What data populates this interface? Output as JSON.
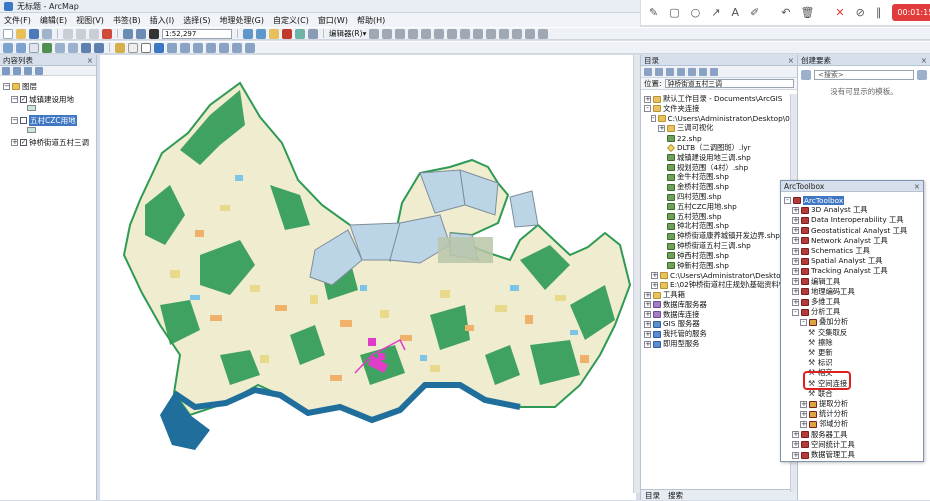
{
  "window": {
    "title": "无标题 - ArcMap"
  },
  "menubar": [
    "文件(F)",
    "编辑(E)",
    "视图(V)",
    "书签(B)",
    "插入(I)",
    "选择(S)",
    "地理处理(G)",
    "自定义(C)",
    "窗口(W)",
    "帮助(H)"
  ],
  "toolbar": {
    "scale": "1:52,297",
    "editor_label": "编辑器(R)▾"
  },
  "recorder": {
    "timer": "00:01:15 结束"
  },
  "toc": {
    "title": "内容列表",
    "root": "图层",
    "layers": [
      {
        "name": "城镇建设用地",
        "checked": true,
        "swatch": "#c6e7e2"
      },
      {
        "name": "五村CZC用地",
        "checked": false,
        "selected": true,
        "swatch": "#c6e7e2"
      },
      {
        "name": "钟桥街道五村三调",
        "checked": true,
        "swatch": ""
      }
    ]
  },
  "catalog": {
    "title": "目录",
    "location_label": "位置:",
    "location_value": "钟桥街道五村三调",
    "items": [
      {
        "label": "默认工作目录 - Documents\\ArcGIS",
        "indent": 0,
        "icon": "folder",
        "exp": "+"
      },
      {
        "label": "文件夹连接",
        "indent": 0,
        "icon": "folder",
        "exp": "-"
      },
      {
        "label": "C:\\Users\\Administrator\\Desktop\\02钟",
        "indent": 1,
        "icon": "folder",
        "exp": "-"
      },
      {
        "label": "三调可视化",
        "indent": 2,
        "icon": "folder",
        "exp": "+"
      },
      {
        "label": "22.shp",
        "indent": 2,
        "icon": "shp",
        "exp": ""
      },
      {
        "label": "DLTB（二调图斑）.lyr",
        "indent": 2,
        "icon": "lyr",
        "exp": ""
      },
      {
        "label": "城镇建设用地三调.shp",
        "indent": 2,
        "icon": "shp",
        "exp": ""
      },
      {
        "label": "规划范围（4村）.shp",
        "indent": 2,
        "icon": "shp",
        "exp": ""
      },
      {
        "label": "金牛村范围.shp",
        "indent": 2,
        "icon": "shp",
        "exp": ""
      },
      {
        "label": "金桥村范围.shp",
        "indent": 2,
        "icon": "shp",
        "exp": ""
      },
      {
        "label": "四村范围.shp",
        "indent": 2,
        "icon": "shp",
        "exp": ""
      },
      {
        "label": "五村CZC用地.shp",
        "indent": 2,
        "icon": "shp",
        "exp": ""
      },
      {
        "label": "五村范围.shp",
        "indent": 2,
        "icon": "shp",
        "exp": ""
      },
      {
        "label": "钟北村范围.shp",
        "indent": 2,
        "icon": "shp",
        "exp": ""
      },
      {
        "label": "钟桥街道康养城镇开发边界.shp",
        "indent": 2,
        "icon": "shp",
        "exp": ""
      },
      {
        "label": "钟桥街道五村三调.shp",
        "indent": 2,
        "icon": "shp",
        "exp": ""
      },
      {
        "label": "钟西村范围.shp",
        "indent": 2,
        "icon": "shp",
        "exp": ""
      },
      {
        "label": "钟新村范围.shp",
        "indent": 2,
        "icon": "shp",
        "exp": ""
      },
      {
        "label": "C:\\Users\\Administrator\\Desktop\\",
        "indent": 1,
        "icon": "folder",
        "exp": "+"
      },
      {
        "label": "E:\\02钟桥街道村庄规划\\基础资料\\新",
        "indent": 1,
        "icon": "folder",
        "exp": "+"
      },
      {
        "label": "工具箱",
        "indent": 0,
        "icon": "folder",
        "exp": "+"
      },
      {
        "label": "数据库服务器",
        "indent": 0,
        "icon": "db",
        "exp": "+"
      },
      {
        "label": "数据库连接",
        "indent": 0,
        "icon": "db",
        "exp": "+"
      },
      {
        "label": "GIS 服务器",
        "indent": 0,
        "icon": "svc",
        "exp": "+"
      },
      {
        "label": "我托管的服务",
        "indent": 0,
        "icon": "svc",
        "exp": "+"
      },
      {
        "label": "即用型服务",
        "indent": 0,
        "icon": "svc",
        "exp": "+"
      }
    ],
    "tabs": [
      "目录",
      "搜索"
    ]
  },
  "create_features": {
    "title": "创建要素",
    "search_placeholder": "<搜索>",
    "empty_text": "没有可显示的模板。"
  },
  "toolbox": {
    "title": "ArcToolbox",
    "items": [
      {
        "label": "ArcToolbox",
        "indent": 0,
        "kind": "root",
        "exp": "-",
        "selected": true
      },
      {
        "label": "3D Analyst 工具",
        "indent": 1,
        "kind": "box",
        "exp": "+"
      },
      {
        "label": "Data Interoperability 工具",
        "indent": 1,
        "kind": "box",
        "exp": "+"
      },
      {
        "label": "Geostatistical Analyst 工具",
        "indent": 1,
        "kind": "box",
        "exp": "+"
      },
      {
        "label": "Network Analyst 工具",
        "indent": 1,
        "kind": "box",
        "exp": "+"
      },
      {
        "label": "Schematics 工具",
        "indent": 1,
        "kind": "box",
        "exp": "+"
      },
      {
        "label": "Spatial Analyst 工具",
        "indent": 1,
        "kind": "box",
        "exp": "+"
      },
      {
        "label": "Tracking Analyst 工具",
        "indent": 1,
        "kind": "box",
        "exp": "+"
      },
      {
        "label": "编辑工具",
        "indent": 1,
        "kind": "box",
        "exp": "+"
      },
      {
        "label": "地理编码工具",
        "indent": 1,
        "kind": "box",
        "exp": "+"
      },
      {
        "label": "多维工具",
        "indent": 1,
        "kind": "box",
        "exp": "+"
      },
      {
        "label": "分析工具",
        "indent": 1,
        "kind": "box",
        "exp": "-"
      },
      {
        "label": "叠加分析",
        "indent": 2,
        "kind": "set",
        "exp": "-"
      },
      {
        "label": "交集取反",
        "indent": 3,
        "kind": "tool",
        "exp": ""
      },
      {
        "label": "擦除",
        "indent": 3,
        "kind": "tool",
        "exp": ""
      },
      {
        "label": "更新",
        "indent": 3,
        "kind": "tool",
        "exp": ""
      },
      {
        "label": "标识",
        "indent": 3,
        "kind": "tool",
        "exp": ""
      },
      {
        "label": "相交",
        "indent": 3,
        "kind": "tool",
        "exp": ""
      },
      {
        "label": "空间连接",
        "indent": 3,
        "kind": "tool",
        "exp": ""
      },
      {
        "label": "联合",
        "indent": 3,
        "kind": "tool",
        "exp": ""
      },
      {
        "label": "提取分析",
        "indent": 2,
        "kind": "set",
        "exp": "+"
      },
      {
        "label": "统计分析",
        "indent": 2,
        "kind": "set",
        "exp": "+"
      },
      {
        "label": "邻域分析",
        "indent": 2,
        "kind": "set",
        "exp": "+"
      },
      {
        "label": "服务器工具",
        "indent": 1,
        "kind": "box",
        "exp": "+"
      },
      {
        "label": "空间统计工具",
        "indent": 1,
        "kind": "box",
        "exp": "+"
      },
      {
        "label": "数据管理工具",
        "indent": 1,
        "kind": "box",
        "exp": "+"
      }
    ]
  },
  "colors": {
    "map_base": "#efeccf",
    "forest": "#2e9a54",
    "water": "#7ec4e6",
    "river_dark": "#1f6e9b",
    "zone_fill": "#bcd5e6",
    "crop": "#e9d98a",
    "urban": "#f0b26b",
    "accent_red": "#e02020",
    "magenta": "#e03cc8"
  }
}
